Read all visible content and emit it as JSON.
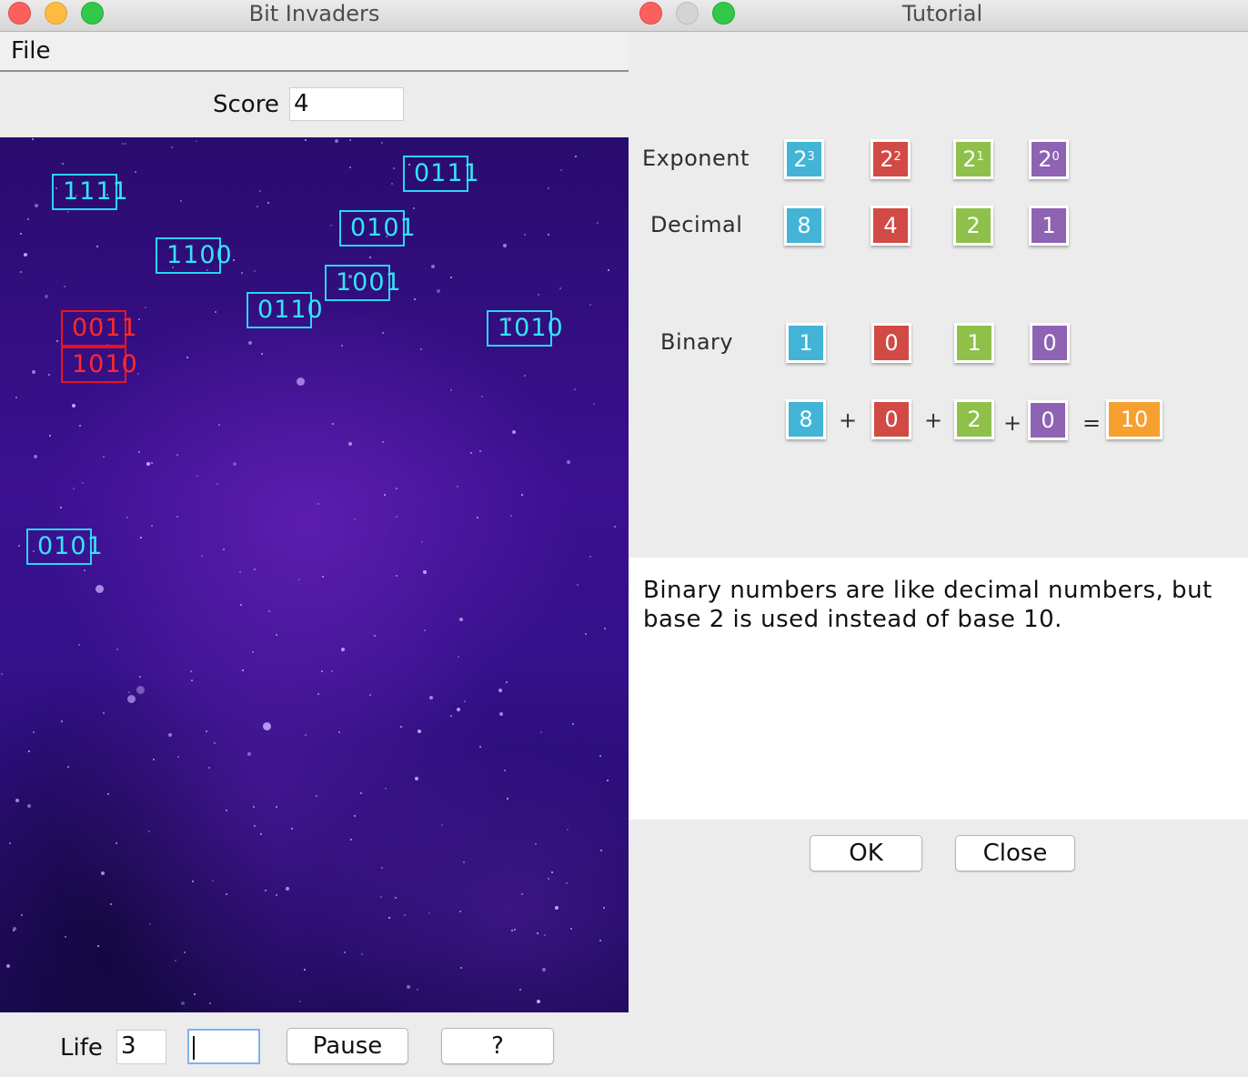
{
  "game_window": {
    "title": "Bit Invaders",
    "menu": {
      "file": "File"
    },
    "score": {
      "label": "Score",
      "value": "4"
    },
    "invaders_cyan": [
      "1111",
      "0111",
      "0101",
      "1100",
      "1001",
      "0110",
      "1010",
      "0101"
    ],
    "invaders_red": [
      "0011",
      "1010"
    ],
    "bottom": {
      "life_label": "Life",
      "life_value": "3",
      "answer_value": "",
      "pause_label": "Pause",
      "help_label": "?"
    }
  },
  "tutorial_window": {
    "title": "Tutorial",
    "labels": {
      "exponent": "Exponent",
      "decimal": "Decimal",
      "binary": "Binary"
    },
    "exponent_base": "2",
    "exponents": [
      "3",
      "2",
      "1",
      "0"
    ],
    "decimal_values": [
      "8",
      "4",
      "2",
      "1"
    ],
    "binary_digits": [
      "1",
      "0",
      "1",
      "0"
    ],
    "sum_terms": [
      "8",
      "0",
      "2",
      "0"
    ],
    "operators": {
      "plus": "+",
      "equals": "="
    },
    "sum_result": "10",
    "explanation": "Binary numbers are like decimal numbers, but base 2 is used instead of base 10.",
    "buttons": {
      "ok": "OK",
      "close": "Close"
    }
  },
  "colors": {
    "bit3": "#43b4d6",
    "bit2": "#d24a45",
    "bit1": "#8fc14a",
    "bit0": "#8e63b3",
    "result": "#f6a030",
    "invader_cyan": "#28d7ee",
    "invader_red": "#e8141c"
  }
}
